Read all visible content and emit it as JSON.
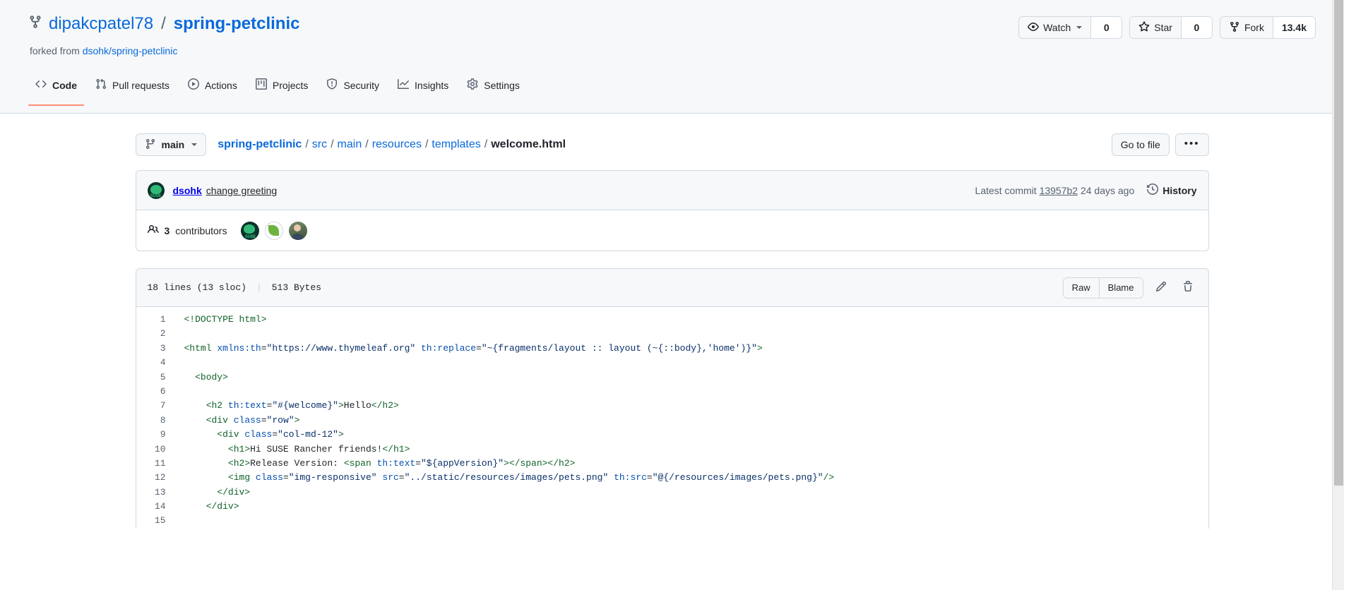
{
  "repo": {
    "owner": "dipakcpatel78",
    "slash": "/",
    "name": "spring-petclinic",
    "forked_from_label": "forked from",
    "forked_from_repo": "dsohk/spring-petclinic",
    "repo_icon": "repo-forked-icon"
  },
  "actions": {
    "watch": {
      "label": "Watch",
      "count": "0",
      "icon": "eye-icon"
    },
    "star": {
      "label": "Star",
      "count": "0",
      "icon": "star-icon"
    },
    "fork": {
      "label": "Fork",
      "count": "13.4k",
      "icon": "repo-forked-icon"
    }
  },
  "nav": {
    "tabs": [
      {
        "label": "Code",
        "icon": "code-icon",
        "active": true
      },
      {
        "label": "Pull requests",
        "icon": "git-pull-request-icon",
        "active": false
      },
      {
        "label": "Actions",
        "icon": "play-icon",
        "active": false
      },
      {
        "label": "Projects",
        "icon": "project-icon",
        "active": false
      },
      {
        "label": "Security",
        "icon": "shield-icon",
        "active": false
      },
      {
        "label": "Insights",
        "icon": "graph-icon",
        "active": false
      },
      {
        "label": "Settings",
        "icon": "gear-icon",
        "active": false
      }
    ],
    "active_underline_color": "#fd8c73"
  },
  "toolbar": {
    "branch": {
      "label": "main",
      "icon": "git-branch-icon"
    },
    "breadcrumb": {
      "root": "spring-petclinic",
      "parts": [
        "src",
        "main",
        "resources",
        "templates"
      ],
      "current": "welcome.html",
      "separator": "/"
    },
    "go_to_file_label": "Go to file",
    "more_label": "•••"
  },
  "commit": {
    "author": "dsohk",
    "message": "change greeting",
    "latest_commit_label": "Latest commit",
    "sha": "13957b2",
    "relative_time": "24 days ago",
    "history_label": "History",
    "history_icon": "history-icon",
    "avatar": "suse-chameleon-avatar"
  },
  "contributors": {
    "icon": "people-icon",
    "count": "3",
    "label": "contributors",
    "avatars": [
      "suse-chameleon-avatar",
      "spring-leaf-avatar",
      "person-photo-avatar"
    ]
  },
  "file": {
    "lines_label": "18 lines (13 sloc)",
    "size_label": "513 Bytes",
    "raw_label": "Raw",
    "blame_label": "Blame",
    "edit_icon": "pencil-icon",
    "delete_icon": "trash-icon"
  },
  "code": {
    "lines": [
      {
        "n": "1",
        "tokens": [
          {
            "t": "<!DOCTYPE html>",
            "c": "t-tag"
          }
        ]
      },
      {
        "n": "2",
        "tokens": []
      },
      {
        "n": "3",
        "tokens": [
          {
            "t": "<html ",
            "c": "t-tag"
          },
          {
            "t": "xmlns:th",
            "c": "t-attr"
          },
          {
            "t": "=",
            "c": "t-punc"
          },
          {
            "t": "\"https://www.thymeleaf.org\"",
            "c": "t-str"
          },
          {
            "t": " ",
            "c": "t-punc"
          },
          {
            "t": "th:replace",
            "c": "t-attr"
          },
          {
            "t": "=",
            "c": "t-punc"
          },
          {
            "t": "\"~{fragments/layout :: layout (~{::body},'home')}\"",
            "c": "t-str"
          },
          {
            "t": ">",
            "c": "t-tag"
          }
        ]
      },
      {
        "n": "4",
        "tokens": []
      },
      {
        "n": "5",
        "tokens": [
          {
            "t": "  <body>",
            "c": "t-tag"
          }
        ]
      },
      {
        "n": "6",
        "tokens": []
      },
      {
        "n": "7",
        "tokens": [
          {
            "t": "    <h2 ",
            "c": "t-tag"
          },
          {
            "t": "th:text",
            "c": "t-attr"
          },
          {
            "t": "=",
            "c": "t-punc"
          },
          {
            "t": "\"#{welcome}\"",
            "c": "t-str"
          },
          {
            "t": ">",
            "c": "t-tag"
          },
          {
            "t": "Hello",
            "c": "t-punc"
          },
          {
            "t": "</h2>",
            "c": "t-tag"
          }
        ]
      },
      {
        "n": "8",
        "tokens": [
          {
            "t": "    <div ",
            "c": "t-tag"
          },
          {
            "t": "class",
            "c": "t-attr"
          },
          {
            "t": "=",
            "c": "t-punc"
          },
          {
            "t": "\"row\"",
            "c": "t-str"
          },
          {
            "t": ">",
            "c": "t-tag"
          }
        ]
      },
      {
        "n": "9",
        "tokens": [
          {
            "t": "      <div ",
            "c": "t-tag"
          },
          {
            "t": "class",
            "c": "t-attr"
          },
          {
            "t": "=",
            "c": "t-punc"
          },
          {
            "t": "\"col-md-12\"",
            "c": "t-str"
          },
          {
            "t": ">",
            "c": "t-tag"
          }
        ]
      },
      {
        "n": "10",
        "tokens": [
          {
            "t": "        <h1>",
            "c": "t-tag"
          },
          {
            "t": "Hi SUSE Rancher friends!",
            "c": "t-punc"
          },
          {
            "t": "</h1>",
            "c": "t-tag"
          }
        ]
      },
      {
        "n": "11",
        "tokens": [
          {
            "t": "        <h2>",
            "c": "t-tag"
          },
          {
            "t": "Release Version: ",
            "c": "t-punc"
          },
          {
            "t": "<span ",
            "c": "t-tag"
          },
          {
            "t": "th:text",
            "c": "t-attr"
          },
          {
            "t": "=",
            "c": "t-punc"
          },
          {
            "t": "\"${appVersion}\"",
            "c": "t-str"
          },
          {
            "t": "></span></h2>",
            "c": "t-tag"
          }
        ]
      },
      {
        "n": "12",
        "tokens": [
          {
            "t": "        <img ",
            "c": "t-tag"
          },
          {
            "t": "class",
            "c": "t-attr"
          },
          {
            "t": "=",
            "c": "t-punc"
          },
          {
            "t": "\"img-responsive\"",
            "c": "t-str"
          },
          {
            "t": " ",
            "c": "t-punc"
          },
          {
            "t": "src",
            "c": "t-attr"
          },
          {
            "t": "=",
            "c": "t-punc"
          },
          {
            "t": "\"../static/resources/images/pets.png\"",
            "c": "t-str"
          },
          {
            "t": " ",
            "c": "t-punc"
          },
          {
            "t": "th:src",
            "c": "t-attr"
          },
          {
            "t": "=",
            "c": "t-punc"
          },
          {
            "t": "\"@{/resources/images/pets.png}\"",
            "c": "t-str"
          },
          {
            "t": "/>",
            "c": "t-tag"
          }
        ]
      },
      {
        "n": "13",
        "tokens": [
          {
            "t": "      </div>",
            "c": "t-tag"
          }
        ]
      },
      {
        "n": "14",
        "tokens": [
          {
            "t": "    </div>",
            "c": "t-tag"
          }
        ]
      },
      {
        "n": "15",
        "tokens": []
      }
    ]
  }
}
